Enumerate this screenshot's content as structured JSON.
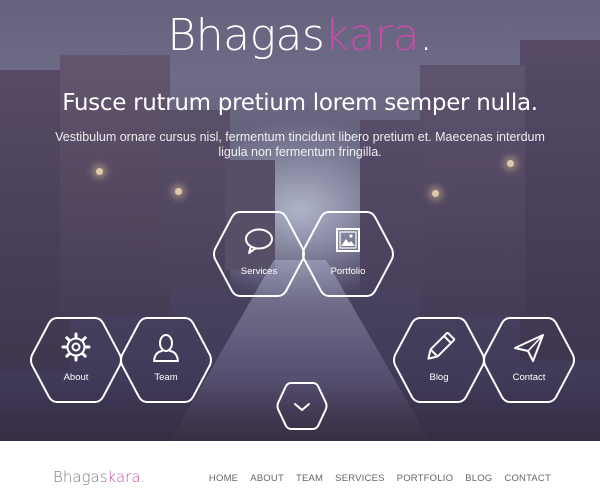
{
  "brand": {
    "name_part1": "Bhagas",
    "name_part2": "kara",
    "dot": ".",
    "accent_color": "#c64ea6"
  },
  "hero": {
    "headline": "Fusce rutrum pretium lorem semper nulla.",
    "subtext": "Vestibulum ornare cursus nisl, fermentum tincidunt libero pretium et. Maecenas interdum ligula non fermentum fringilla."
  },
  "tiles": {
    "services": {
      "label": "Services",
      "icon": "speech-bubble-icon"
    },
    "portfolio": {
      "label": "Portfolio",
      "icon": "picture-icon"
    },
    "about": {
      "label": "About",
      "icon": "gear-icon"
    },
    "team": {
      "label": "Team",
      "icon": "person-icon"
    },
    "blog": {
      "label": "Blog",
      "icon": "pencil-icon"
    },
    "contact": {
      "label": "Contact",
      "icon": "paper-plane-icon"
    }
  },
  "scroll_down": {
    "icon": "chevron-down-icon"
  },
  "nav": {
    "home": "HOME",
    "about": "ABOUT",
    "team": "TEAM",
    "services": "SERVICES",
    "portfolio": "PORTFOLIO",
    "blog": "BLOG",
    "contact": "CONTACT"
  }
}
